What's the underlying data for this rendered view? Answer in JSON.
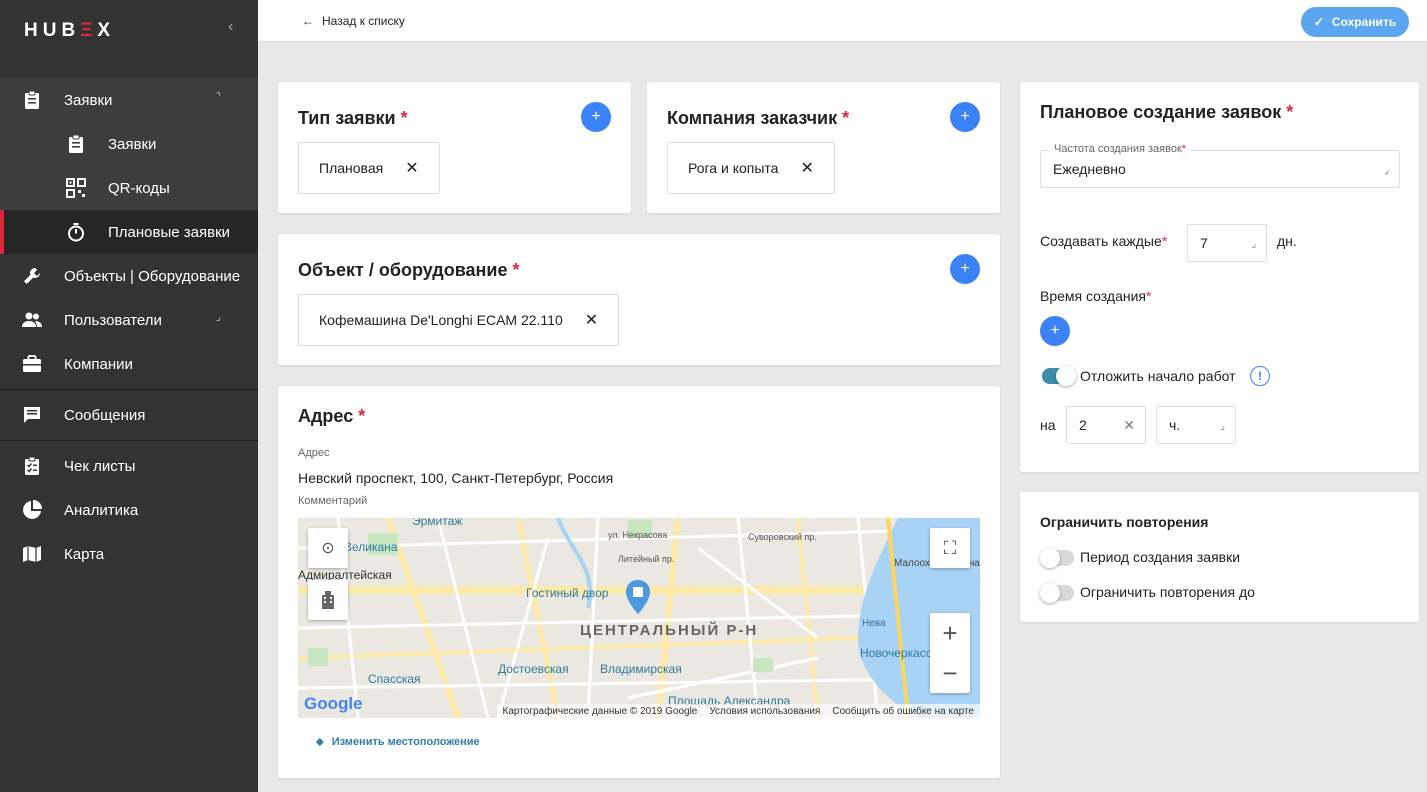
{
  "sidebar": {
    "logo": {
      "part1": "HU",
      "part2": "B",
      "part3": "Ξ",
      "part4": "X"
    },
    "collapse_icon": "chevron-left-icon",
    "items": [
      {
        "label": "Заявки",
        "icon": "clipboard-icon"
      },
      {
        "label": "Заявки",
        "icon": "clipboard-icon"
      },
      {
        "label": "QR-коды",
        "icon": "qr-code-icon"
      },
      {
        "label": "Плановые заявки",
        "icon": "stopwatch-icon"
      },
      {
        "label": "Объекты | Оборудование",
        "icon": "wrench-icon"
      },
      {
        "label": "Пользователи",
        "icon": "users-icon"
      },
      {
        "label": "Компании",
        "icon": "briefcase-icon"
      },
      {
        "label": "Сообщения",
        "icon": "message-icon"
      },
      {
        "label": "Чек листы",
        "icon": "checklist-icon"
      },
      {
        "label": "Аналитика",
        "icon": "pie-chart-icon"
      },
      {
        "label": "Карта",
        "icon": "map-icon"
      }
    ]
  },
  "topbar": {
    "back_label": "Назад к списку",
    "save_label": "Сохранить"
  },
  "request_type": {
    "title": "Тип заявки",
    "required_mark": "*",
    "value": "Плановая"
  },
  "customer": {
    "title": "Компания заказчик",
    "required_mark": "*",
    "value": "Рога и копыта"
  },
  "equipment": {
    "title": "Объект / оборудование",
    "required_mark": "*",
    "value": "Кофемашина De'Longhi ECAM 22.110"
  },
  "address": {
    "title": "Адрес",
    "required_mark": "*",
    "address_label": "Адрес",
    "address_value": "Невский проспект, 100, Санкт-Петербург, Россия",
    "comment_label": "Комментарий",
    "map_labels": [
      "Эрмитаж",
      "Великана",
      "Адмиралтейская",
      "Гостиный двор",
      "ЦЕНТРАЛЬНЫЙ Р-Н",
      "Достоевская",
      "Владимирская",
      "Спасская",
      "Новочеркасская",
      "Площадь Александра",
      "ул. Некрасова",
      "Литейный пр.",
      "Нева",
      "Малоохтинская наб.",
      "Суворовский пр."
    ],
    "map_footer": {
      "copyright": "Картографические данные © 2019 Google",
      "terms": "Условия использования",
      "report": "Сообщить об ошибке на карте",
      "brand": "Google"
    },
    "change_location_label": "Изменить местоположение"
  },
  "planned": {
    "title": "Плановое создание заявок",
    "required_mark": "*",
    "frequency_label": "Частота создания заявок",
    "frequency_value": "Ежедневно",
    "every_label": "Создавать каждые",
    "every_value": "7",
    "every_unit": "дн.",
    "time_label": "Время создания",
    "delay_toggle_label": "Отложить начало работ",
    "delay_on": true,
    "delay_prefix": "на",
    "delay_value": "2",
    "delay_unit": "ч."
  },
  "limits": {
    "title": "Ограничить повторения",
    "option1": "Период создания заявки",
    "option2": "Ограничить повторения до"
  },
  "colors": {
    "accent": "#3b82f6",
    "required": "#e0263c",
    "sidebar": "#333333",
    "toggle_on": "#3b8da8"
  }
}
